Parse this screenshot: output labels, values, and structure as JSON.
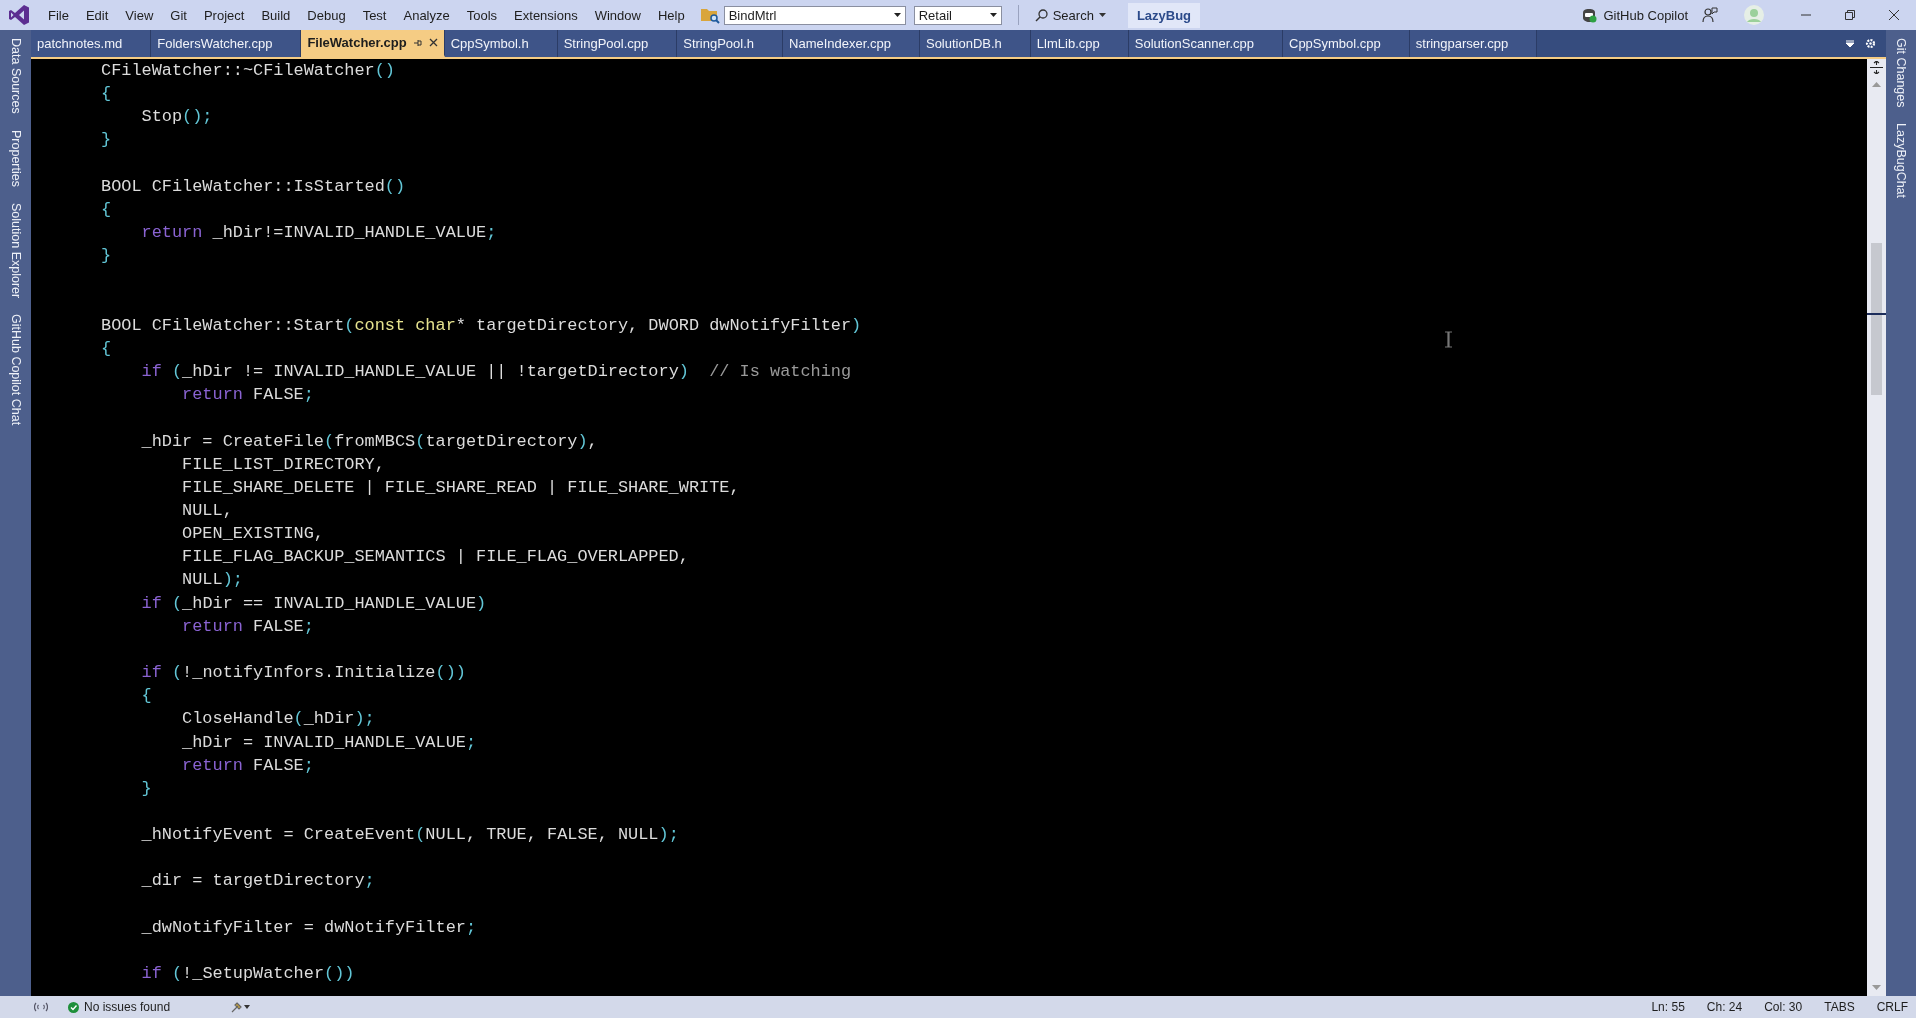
{
  "menu": [
    "File",
    "Edit",
    "View",
    "Git",
    "Project",
    "Build",
    "Debug",
    "Test",
    "Analyze",
    "Tools",
    "Extensions",
    "Window",
    "Help"
  ],
  "solution_combo": {
    "value": "BindMtrl"
  },
  "config_combo": {
    "value": "Retail"
  },
  "search_button": "Search",
  "lazybug_button": "LazyBug",
  "copilot_button": "GitHub Copilot",
  "left_panels": [
    "Data Sources",
    "Properties",
    "Solution Explorer",
    "GitHub Copilot Chat"
  ],
  "right_panels": [
    "Git Changes",
    "LazyBugChat"
  ],
  "tabs": [
    {
      "label": "patchnotes.md",
      "selected": false
    },
    {
      "label": "FoldersWatcher.cpp",
      "selected": false
    },
    {
      "label": "FileWatcher.cpp",
      "selected": true
    },
    {
      "label": "CppSymbol.h",
      "selected": false
    },
    {
      "label": "StringPool.cpp",
      "selected": false
    },
    {
      "label": "StringPool.h",
      "selected": false
    },
    {
      "label": "NameIndexer.cpp",
      "selected": false
    },
    {
      "label": "SolutionDB.h",
      "selected": false
    },
    {
      "label": "LlmLib.cpp",
      "selected": false
    },
    {
      "label": "SolutionScanner.cpp",
      "selected": false
    },
    {
      "label": "CppSymbol.cpp",
      "selected": false
    },
    {
      "label": "stringparser.cpp",
      "selected": false
    }
  ],
  "code_lines": [
    {
      "kind": "code",
      "segments": [
        {
          "kind": "plain",
          "text": "CFileWatcher::~CFileWatcher"
        },
        {
          "kind": "punct",
          "text": "()"
        }
      ]
    },
    {
      "kind": "code",
      "segments": [
        {
          "kind": "punct",
          "text": "{"
        }
      ]
    },
    {
      "kind": "code",
      "segments": [
        {
          "kind": "plain",
          "text": "    Stop"
        },
        {
          "kind": "punct",
          "text": "();"
        }
      ]
    },
    {
      "kind": "code",
      "segments": [
        {
          "kind": "punct",
          "text": "}"
        }
      ]
    },
    {
      "kind": "blank"
    },
    {
      "kind": "code",
      "segments": [
        {
          "kind": "plain",
          "text": "BOOL CFileWatcher::IsStarted"
        },
        {
          "kind": "punct",
          "text": "()"
        }
      ]
    },
    {
      "kind": "code",
      "segments": [
        {
          "kind": "punct",
          "text": "{"
        }
      ]
    },
    {
      "kind": "code",
      "segments": [
        {
          "kind": "keyword",
          "text": "    return"
        },
        {
          "kind": "plain",
          "text": " _hDir!=INVALID_HANDLE_VALUE"
        },
        {
          "kind": "punct",
          "text": ";"
        }
      ]
    },
    {
      "kind": "code",
      "segments": [
        {
          "kind": "punct",
          "text": "}"
        }
      ]
    },
    {
      "kind": "blank"
    },
    {
      "kind": "blank"
    },
    {
      "kind": "code",
      "segments": [
        {
          "kind": "plain",
          "text": "BOOL CFileWatcher::Start"
        },
        {
          "kind": "punct",
          "text": "("
        },
        {
          "kind": "type",
          "text": "const char"
        },
        {
          "kind": "plain",
          "text": "* targetDirectory, DWORD dwNotifyFilter"
        },
        {
          "kind": "punct",
          "text": ")"
        }
      ]
    },
    {
      "kind": "code",
      "segments": [
        {
          "kind": "punct",
          "text": "{"
        }
      ]
    },
    {
      "kind": "code",
      "segments": [
        {
          "kind": "keyword",
          "text": "    if"
        },
        {
          "kind": "punct",
          "text": " ("
        },
        {
          "kind": "plain",
          "text": "_hDir != INVALID_HANDLE_VALUE || !targetDirectory"
        },
        {
          "kind": "punct",
          "text": ")"
        },
        {
          "kind": "comment",
          "text": "  // Is watching"
        }
      ]
    },
    {
      "kind": "code",
      "segments": [
        {
          "kind": "keyword",
          "text": "        return"
        },
        {
          "kind": "plain",
          "text": " FALSE"
        },
        {
          "kind": "punct",
          "text": ";"
        }
      ]
    },
    {
      "kind": "blank"
    },
    {
      "kind": "code",
      "segments": [
        {
          "kind": "plain",
          "text": "    _hDir = CreateFile"
        },
        {
          "kind": "punct",
          "text": "("
        },
        {
          "kind": "plain",
          "text": "fromMBCS"
        },
        {
          "kind": "punct",
          "text": "("
        },
        {
          "kind": "plain",
          "text": "targetDirectory"
        },
        {
          "kind": "punct",
          "text": ")"
        },
        {
          "kind": "plain",
          "text": ","
        }
      ]
    },
    {
      "kind": "code",
      "segments": [
        {
          "kind": "plain",
          "text": "        FILE_LIST_DIRECTORY,"
        }
      ]
    },
    {
      "kind": "code",
      "segments": [
        {
          "kind": "plain",
          "text": "        FILE_SHARE_DELETE | FILE_SHARE_READ | FILE_SHARE_WRITE,"
        }
      ]
    },
    {
      "kind": "code",
      "segments": [
        {
          "kind": "plain",
          "text": "        NULL,"
        }
      ]
    },
    {
      "kind": "code",
      "segments": [
        {
          "kind": "plain",
          "text": "        OPEN_EXISTING,"
        }
      ]
    },
    {
      "kind": "code",
      "segments": [
        {
          "kind": "plain",
          "text": "        FILE_FLAG_BACKUP_SEMANTICS | FILE_FLAG_OVERLAPPED,"
        }
      ]
    },
    {
      "kind": "code",
      "segments": [
        {
          "kind": "plain",
          "text": "        NULL"
        },
        {
          "kind": "punct",
          "text": ");"
        }
      ]
    },
    {
      "kind": "code",
      "segments": [
        {
          "kind": "keyword",
          "text": "    if"
        },
        {
          "kind": "punct",
          "text": " ("
        },
        {
          "kind": "plain",
          "text": "_hDir == INVALID_HANDLE_VALUE"
        },
        {
          "kind": "punct",
          "text": ")"
        }
      ]
    },
    {
      "kind": "code",
      "segments": [
        {
          "kind": "keyword",
          "text": "        return"
        },
        {
          "kind": "plain",
          "text": " FALSE"
        },
        {
          "kind": "punct",
          "text": ";"
        }
      ]
    },
    {
      "kind": "blank"
    },
    {
      "kind": "code",
      "segments": [
        {
          "kind": "keyword",
          "text": "    if"
        },
        {
          "kind": "punct",
          "text": " ("
        },
        {
          "kind": "plain",
          "text": "!_notifyInfors.Initialize"
        },
        {
          "kind": "punct",
          "text": "())"
        }
      ]
    },
    {
      "kind": "code",
      "segments": [
        {
          "kind": "punct",
          "text": "    {"
        }
      ]
    },
    {
      "kind": "code",
      "segments": [
        {
          "kind": "plain",
          "text": "        CloseHandle"
        },
        {
          "kind": "punct",
          "text": "("
        },
        {
          "kind": "plain",
          "text": "_hDir"
        },
        {
          "kind": "punct",
          "text": ");"
        }
      ]
    },
    {
      "kind": "code",
      "segments": [
        {
          "kind": "plain",
          "text": "        _hDir = INVALID_HANDLE_VALUE"
        },
        {
          "kind": "punct",
          "text": ";"
        }
      ]
    },
    {
      "kind": "code",
      "segments": [
        {
          "kind": "keyword",
          "text": "        return"
        },
        {
          "kind": "plain",
          "text": " FALSE"
        },
        {
          "kind": "punct",
          "text": ";"
        }
      ]
    },
    {
      "kind": "code",
      "segments": [
        {
          "kind": "punct",
          "text": "    }"
        }
      ]
    },
    {
      "kind": "blank"
    },
    {
      "kind": "code",
      "segments": [
        {
          "kind": "plain",
          "text": "    _hNotifyEvent = CreateEvent"
        },
        {
          "kind": "punct",
          "text": "("
        },
        {
          "kind": "plain",
          "text": "NULL, TRUE, FALSE, NULL"
        },
        {
          "kind": "punct",
          "text": ");"
        }
      ]
    },
    {
      "kind": "blank"
    },
    {
      "kind": "code",
      "segments": [
        {
          "kind": "plain",
          "text": "    _dir = targetDirectory"
        },
        {
          "kind": "punct",
          "text": ";"
        }
      ]
    },
    {
      "kind": "blank"
    },
    {
      "kind": "code",
      "segments": [
        {
          "kind": "plain",
          "text": "    _dwNotifyFilter = dwNotifyFilter"
        },
        {
          "kind": "punct",
          "text": ";"
        }
      ]
    },
    {
      "kind": "blank"
    },
    {
      "kind": "code",
      "segments": [
        {
          "kind": "keyword",
          "text": "    if"
        },
        {
          "kind": "punct",
          "text": " ("
        },
        {
          "kind": "plain",
          "text": "!_SetupWatcher"
        },
        {
          "kind": "punct",
          "text": "())"
        }
      ]
    }
  ],
  "status_bar": {
    "issues": "No issues found",
    "line": "Ln: 55",
    "char": "Ch: 24",
    "col": "Col: 30",
    "indent": "TABS",
    "line_ending": "CRLF"
  }
}
